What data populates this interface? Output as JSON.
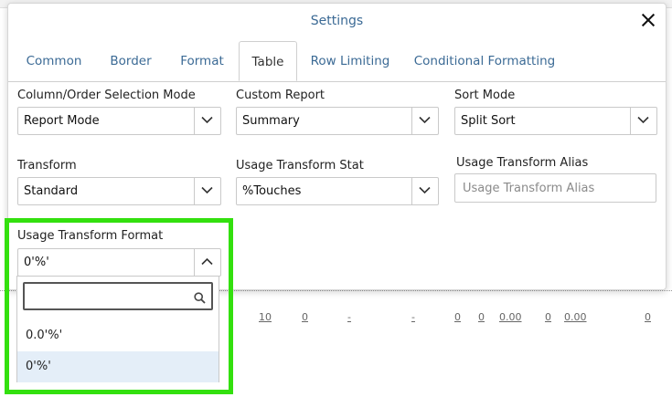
{
  "background": {
    "row_values": [
      "10",
      "0",
      "-",
      "-",
      "0",
      "0",
      "0.00",
      "0",
      "0.00",
      "0"
    ]
  },
  "dialog": {
    "title": "Settings",
    "tabs": [
      {
        "label": "Common"
      },
      {
        "label": "Border"
      },
      {
        "label": "Format"
      },
      {
        "label": "Table",
        "active": true
      },
      {
        "label": "Row Limiting"
      },
      {
        "label": "Conditional Formatting"
      }
    ],
    "fields": {
      "column_order_mode": {
        "label": "Column/Order Selection Mode",
        "value": "Report Mode"
      },
      "custom_report": {
        "label": "Custom Report",
        "value": "Summary"
      },
      "sort_mode": {
        "label": "Sort Mode",
        "value": "Split Sort"
      },
      "transform": {
        "label": "Transform",
        "value": "Standard"
      },
      "usage_transform_stat": {
        "label": "Usage Transform Stat",
        "value": "%Touches"
      },
      "usage_transform_alias": {
        "label": "Usage Transform Alias",
        "value": "",
        "placeholder": "Usage Transform Alias"
      },
      "usage_transform_format": {
        "label": "Usage Transform Format",
        "value": "0'%'"
      }
    }
  },
  "dropdown": {
    "search_value": "",
    "options": [
      {
        "label": "0.0'%'",
        "selected": false
      },
      {
        "label": "0'%'",
        "selected": true
      }
    ]
  },
  "colors": {
    "accent_text": "#3b6a95",
    "highlight_border": "#33e00e",
    "selected_option_bg": "#e4eef8"
  }
}
